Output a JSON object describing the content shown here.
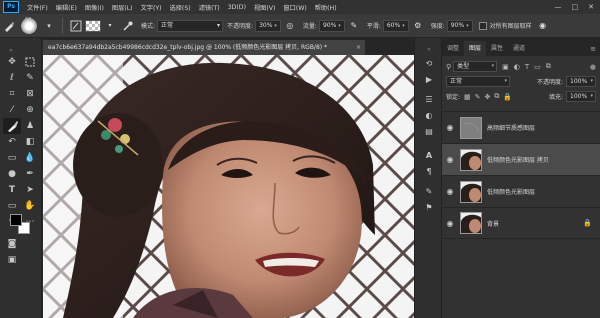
{
  "app": {
    "logo": "Ps"
  },
  "menu": [
    "文件(F)",
    "编辑(E)",
    "图像(I)",
    "图层(L)",
    "文字(Y)",
    "选择(S)",
    "滤镜(T)",
    "3D(D)",
    "视图(V)",
    "窗口(W)",
    "帮助(H)"
  ],
  "window_controls": [
    "—",
    "□",
    "✕"
  ],
  "options": {
    "brush_size": "60",
    "mode_label": "模式:",
    "mode_value": "正常",
    "opacity_label": "不透明度:",
    "opacity_value": "30%",
    "flow_label": "流量:",
    "flow_value": "90%",
    "smoothing_label": "平滑:",
    "smoothing_value": "60%",
    "strength_label": "强度:",
    "strength_value": "90%",
    "sample_all_label": "对所有图层取样"
  },
  "document": {
    "tab_title": "ea7cb6e637a94db2a5cb49986cdcd32e_tplv-obj.jpg @ 100% (低频颜色光影图层 拷贝, RGB/8) *",
    "close": "×"
  },
  "panel": {
    "tabs": [
      "调整",
      "图层",
      "属性",
      "通道"
    ],
    "active_tab": "图层",
    "filter_kind": "类型",
    "blend_mode": "正常",
    "opacity_label": "不透明度:",
    "opacity_value": "100%",
    "lock_label": "锁定:",
    "fill_label": "填充:",
    "fill_value": "100%",
    "layers": [
      {
        "name": "高频细节质感图层",
        "selected": false,
        "thumb": "gray",
        "locked": false
      },
      {
        "name": "低频颜色光影图层 拷贝",
        "selected": true,
        "thumb": "portrait",
        "locked": false
      },
      {
        "name": "低频颜色光影图层",
        "selected": false,
        "thumb": "portrait",
        "locked": false
      },
      {
        "name": "背景",
        "selected": false,
        "thumb": "portrait",
        "locked": true
      }
    ]
  },
  "colors": {
    "accent": "#31a8ff",
    "panel_bg": "#323232",
    "selected_layer": "#4b4b4b"
  }
}
